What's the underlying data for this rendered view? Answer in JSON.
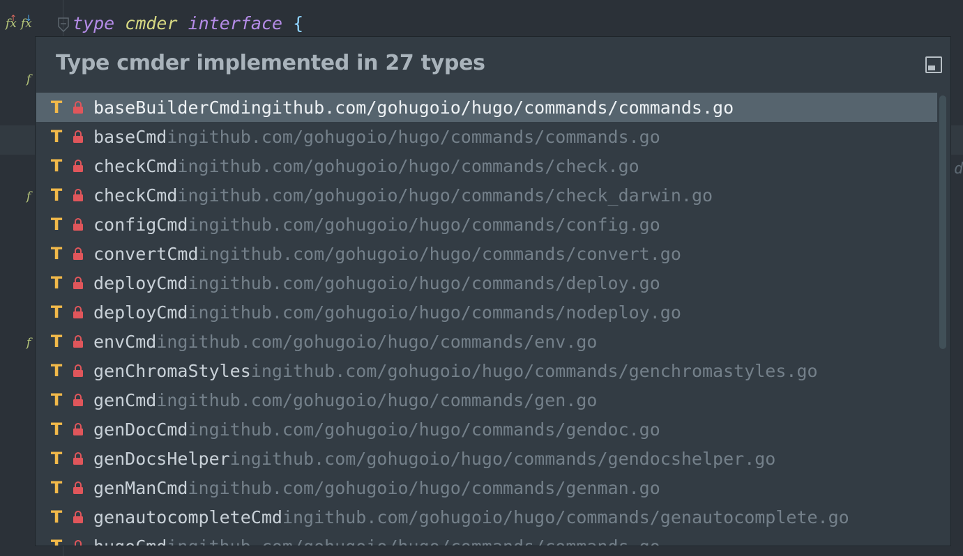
{
  "editor": {
    "code": {
      "keyword": "type",
      "type_name": "cmder",
      "keyword2": "interface",
      "brace": "{"
    },
    "gutter_icons": [
      "implemented-method-icon",
      "implementing-method-icon"
    ],
    "side_glyph": "f",
    "edge_text": "d"
  },
  "popup": {
    "title": "Type cmder implemented in 27 types",
    "total_count": 27,
    "items": [
      {
        "name": "baseBuilderCmd",
        "in": "in",
        "path": "github.com/gohugoio/hugo/commands/commands.go",
        "selected": true
      },
      {
        "name": "baseCmd",
        "in": "in",
        "path": "github.com/gohugoio/hugo/commands/commands.go"
      },
      {
        "name": "checkCmd",
        "in": "in",
        "path": "github.com/gohugoio/hugo/commands/check.go"
      },
      {
        "name": "checkCmd",
        "in": "in",
        "path": "github.com/gohugoio/hugo/commands/check_darwin.go"
      },
      {
        "name": "configCmd",
        "in": "in",
        "path": "github.com/gohugoio/hugo/commands/config.go"
      },
      {
        "name": "convertCmd",
        "in": "in",
        "path": "github.com/gohugoio/hugo/commands/convert.go"
      },
      {
        "name": "deployCmd",
        "in": "in",
        "path": "github.com/gohugoio/hugo/commands/deploy.go"
      },
      {
        "name": "deployCmd",
        "in": "in",
        "path": "github.com/gohugoio/hugo/commands/nodeploy.go"
      },
      {
        "name": "envCmd",
        "in": "in",
        "path": "github.com/gohugoio/hugo/commands/env.go"
      },
      {
        "name": "genChromaStyles",
        "in": "in",
        "path": "github.com/gohugoio/hugo/commands/genchromastyles.go"
      },
      {
        "name": "genCmd",
        "in": "in",
        "path": "github.com/gohugoio/hugo/commands/gen.go"
      },
      {
        "name": "genDocCmd",
        "in": "in",
        "path": "github.com/gohugoio/hugo/commands/gendoc.go"
      },
      {
        "name": "genDocsHelper",
        "in": "in",
        "path": "github.com/gohugoio/hugo/commands/gendocshelper.go"
      },
      {
        "name": "genManCmd",
        "in": "in",
        "path": "github.com/gohugoio/hugo/commands/genman.go"
      },
      {
        "name": "genautocompleteCmd",
        "in": "in",
        "path": "github.com/gohugoio/hugo/commands/genautocomplete.go"
      },
      {
        "name": "hugoCmd",
        "in": "in",
        "path": "github.com/gohugoio/hugo/commands/commands.go"
      }
    ],
    "item_icon": "T",
    "item_icon_name": "type-icon",
    "lock_icon_name": "lock-icon"
  },
  "colors": {
    "type_icon": "#f2b94a",
    "lock_icon": "#e0565b",
    "selection": "#56646e",
    "keyword": "#b58ce8",
    "type_name": "#d7d982"
  }
}
